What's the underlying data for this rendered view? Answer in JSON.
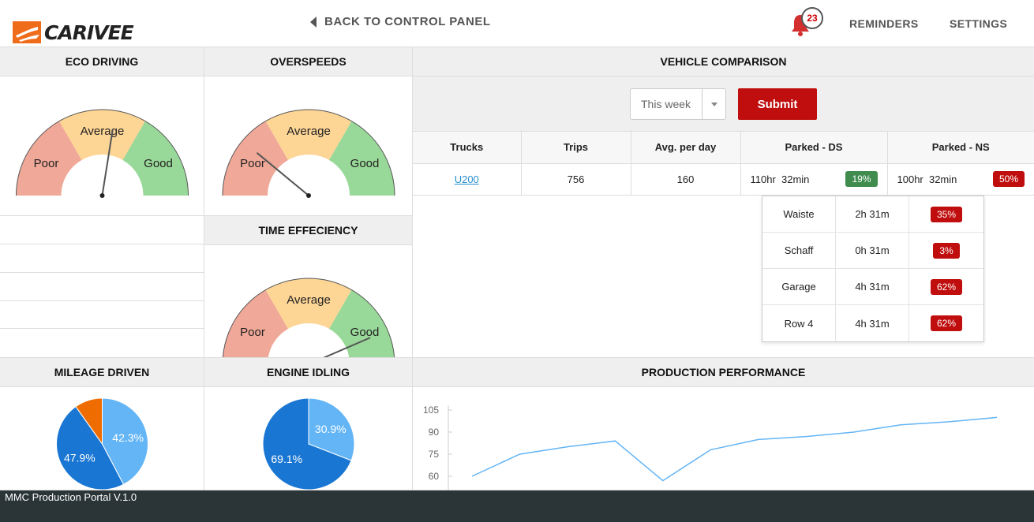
{
  "header": {
    "brand": "CARIVEE",
    "back_label": "BACK TO CONTROL PANEL",
    "notification_count": "23",
    "reminders_label": "REMINDERS",
    "settings_label": "SETTINGS"
  },
  "eco_driving": {
    "title": "ECO DRIVING",
    "labels": {
      "poor": "Poor",
      "average": "Average",
      "good": "Good"
    },
    "needle_value": 0.55
  },
  "overspeeds": {
    "title": "OVERSPEEDS",
    "labels": {
      "poor": "Poor",
      "average": "Average",
      "good": "Good"
    },
    "needle_value": 0.22
  },
  "time_efficiency": {
    "title": "TIME EFFECIENCY",
    "labels": {
      "poor": "Poor",
      "average": "Average",
      "good": "Good"
    },
    "needle_value": 0.87
  },
  "vehicle_comparison": {
    "title": "VEHICLE COMPARISON",
    "period_value": "This week",
    "submit_label": "Submit",
    "columns": [
      "Trucks",
      "Trips",
      "Avg. per day",
      "Parked - DS",
      "Parked - NS"
    ],
    "rows": [
      {
        "truck": "U200",
        "trips": "756",
        "avg": "160",
        "ds_time": "110hr  32min",
        "ds_pct": "19%",
        "ns_time": "100hr  32min",
        "ns_pct": "50%"
      }
    ],
    "dropdown": [
      {
        "name": "Waiste",
        "time": "2h 31m",
        "pct": "35%"
      },
      {
        "name": "Schaff",
        "time": "0h 31m",
        "pct": "3%"
      },
      {
        "name": "Garage",
        "time": "4h 31m",
        "pct": "62%"
      },
      {
        "name": "Row 4",
        "time": "4h 31m",
        "pct": "62%"
      }
    ]
  },
  "mileage_driven": {
    "title": "MILEAGE DRIVEN",
    "chart_data": {
      "type": "pie",
      "values": [
        42.3,
        47.9,
        9.8
      ],
      "labels": [
        "42.3%",
        "47.9%",
        ""
      ],
      "colors": [
        "#64b5f6",
        "#1976d2",
        "#ef6c00"
      ]
    }
  },
  "engine_idling": {
    "title": "ENGINE IDLING",
    "chart_data": {
      "type": "pie",
      "values": [
        30.9,
        69.1
      ],
      "labels": [
        "30.9%",
        "69.1%"
      ],
      "colors": [
        "#64b5f6",
        "#1976d2"
      ]
    }
  },
  "production_performance": {
    "title": "PRODUCTION PERFORMANCE",
    "chart_data": {
      "type": "line",
      "y_ticks": [
        "105",
        "90",
        "75",
        "60"
      ],
      "ylim": [
        55,
        105
      ],
      "values": [
        60,
        75,
        80,
        84,
        57,
        78,
        85,
        87,
        90,
        95,
        97,
        100
      ],
      "color": "#64b5f6"
    }
  },
  "footer": {
    "text": "MMC Production Portal V.1.0"
  }
}
